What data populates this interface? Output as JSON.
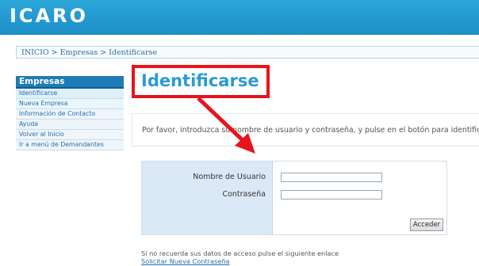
{
  "header": {
    "logo": "ICARO"
  },
  "breadcrumb": {
    "text": "INICIO > Empresas > Identificarse"
  },
  "sidebar": {
    "title": "Empresas",
    "items": [
      {
        "label": "Identificarse"
      },
      {
        "label": "Nueva Empresa"
      },
      {
        "label": "Información de Contacto"
      },
      {
        "label": "Ayuda"
      },
      {
        "label": "Volver al Inicio"
      },
      {
        "label": "Ir a menú de Demandantes"
      }
    ]
  },
  "main": {
    "title": "Identificarse",
    "intro": "Por favor, introduzca su nombre de usuario y contraseña, y pulse en el botón para identificarse",
    "login": {
      "username_label": "Nombre de Usuario",
      "password_label": "Contraseña",
      "username_value": "",
      "password_value": "",
      "submit_label": "Acceder"
    },
    "forgot_text": "Si no recuerda sus datos de acceso pulse el siguiente enlace",
    "forgot_link": "Solicitar Nueva Contraseña"
  },
  "annotation": {
    "color": "#e8141b"
  }
}
